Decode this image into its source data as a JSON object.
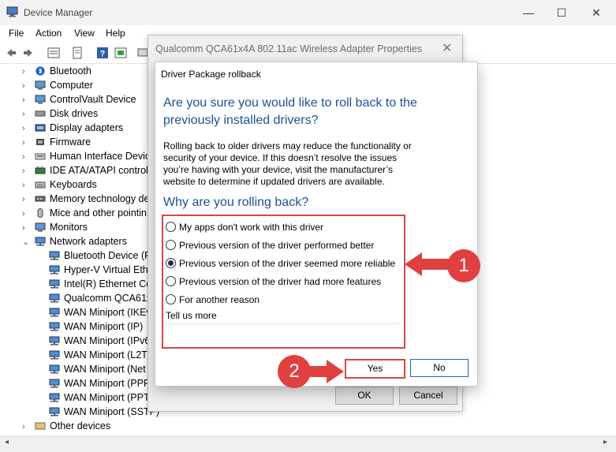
{
  "window": {
    "title": "Device Manager",
    "controls": {
      "minimize": "—",
      "maximize": "☐",
      "close": "✕"
    }
  },
  "menu": [
    "File",
    "Action",
    "View",
    "Help"
  ],
  "tree": {
    "items": [
      {
        "label": "Bluetooth",
        "indent": 0,
        "expander": "›",
        "icon": "bluetooth-icon"
      },
      {
        "label": "Computer",
        "indent": 0,
        "expander": "›",
        "icon": "monitor-icon"
      },
      {
        "label": "ControlVault Device",
        "indent": 0,
        "expander": "›",
        "icon": "monitor-icon"
      },
      {
        "label": "Disk drives",
        "indent": 0,
        "expander": "›",
        "icon": "disk-icon"
      },
      {
        "label": "Display adapters",
        "indent": 0,
        "expander": "›",
        "icon": "display-icon"
      },
      {
        "label": "Firmware",
        "indent": 0,
        "expander": "›",
        "icon": "chip-icon"
      },
      {
        "label": "Human Interface Devic",
        "indent": 0,
        "expander": "›",
        "icon": "hid-icon"
      },
      {
        "label": "IDE ATA/ATAPI controlle",
        "indent": 0,
        "expander": "›",
        "icon": "ide-icon"
      },
      {
        "label": "Keyboards",
        "indent": 0,
        "expander": "›",
        "icon": "keyboard-icon"
      },
      {
        "label": "Memory technology de",
        "indent": 0,
        "expander": "›",
        "icon": "memory-icon"
      },
      {
        "label": "Mice and other pointin",
        "indent": 0,
        "expander": "›",
        "icon": "mouse-icon"
      },
      {
        "label": "Monitors",
        "indent": 0,
        "expander": "›",
        "icon": "monitor-icon"
      },
      {
        "label": "Network adapters",
        "indent": 0,
        "expander": "⌄",
        "icon": "network-icon"
      },
      {
        "label": "Bluetooth Device (P",
        "indent": 1,
        "expander": "",
        "icon": "network-icon"
      },
      {
        "label": "Hyper-V Virtual Eth",
        "indent": 1,
        "expander": "",
        "icon": "network-icon"
      },
      {
        "label": "Intel(R) Ethernet Co",
        "indent": 1,
        "expander": "",
        "icon": "network-icon"
      },
      {
        "label": "Qualcomm QCA61x",
        "indent": 1,
        "expander": "",
        "icon": "network-icon"
      },
      {
        "label": "WAN Miniport (IKEv",
        "indent": 1,
        "expander": "",
        "icon": "network-icon"
      },
      {
        "label": "WAN Miniport (IP)",
        "indent": 1,
        "expander": "",
        "icon": "network-icon"
      },
      {
        "label": "WAN Miniport (IPv6",
        "indent": 1,
        "expander": "",
        "icon": "network-icon"
      },
      {
        "label": "WAN Miniport (L2T",
        "indent": 1,
        "expander": "",
        "icon": "network-icon"
      },
      {
        "label": "WAN Miniport (Net",
        "indent": 1,
        "expander": "",
        "icon": "network-icon"
      },
      {
        "label": "WAN Miniport (PPP",
        "indent": 1,
        "expander": "",
        "icon": "network-icon"
      },
      {
        "label": "WAN Miniport (PPT",
        "indent": 1,
        "expander": "",
        "icon": "network-icon"
      },
      {
        "label": "WAN Miniport (SSTP)",
        "indent": 1,
        "expander": "",
        "icon": "network-icon"
      },
      {
        "label": "Other devices",
        "indent": 0,
        "expander": "›",
        "icon": "other-icon"
      }
    ]
  },
  "properties": {
    "title": "Qualcomm QCA61x4A 802.11ac Wireless Adapter Properties",
    "close": "✕",
    "ok_label": "OK",
    "cancel_label": "Cancel"
  },
  "dialog": {
    "title": "Driver Package rollback",
    "question": "Are you sure you would like to roll back to the previously installed drivers?",
    "description": "Rolling back to older drivers may reduce the functionality or security of your device.  If this doesn’t resolve the issues you’re having with your device, visit the manufacturer’s website to determine if updated drivers are available.",
    "why_heading": "Why are you rolling back?",
    "options": [
      {
        "label": "My apps don't work with this driver",
        "selected": false
      },
      {
        "label": "Previous version of the driver performed better",
        "selected": false
      },
      {
        "label": "Previous version of the driver seemed more reliable",
        "selected": true
      },
      {
        "label": "Previous version of the driver had more features",
        "selected": false
      },
      {
        "label": "For another reason",
        "selected": false
      }
    ],
    "tell_us_label": "Tell us more",
    "tell_us_value": "",
    "yes_label": "Yes",
    "no_label": "No"
  },
  "annotations": {
    "step1": "1",
    "step2": "2",
    "color": "#e0403f"
  }
}
